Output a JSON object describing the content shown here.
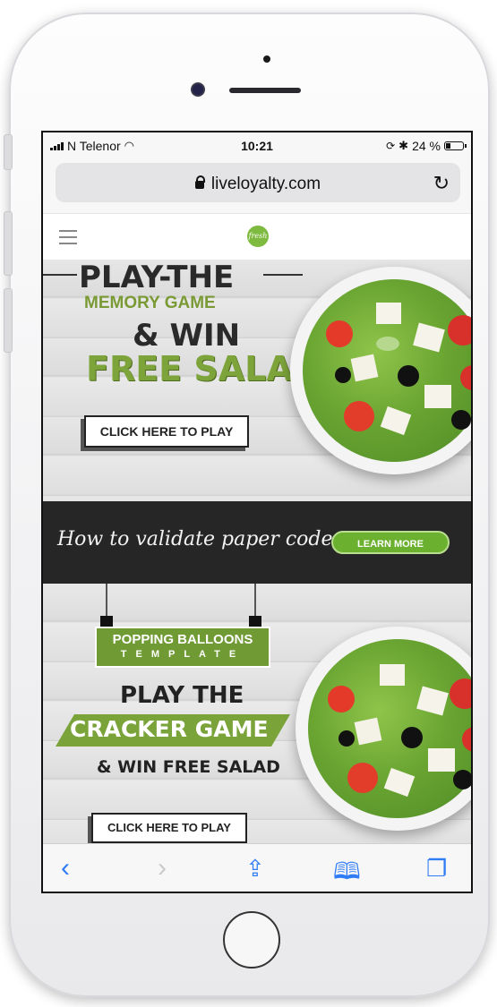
{
  "statusbar": {
    "carrier": "N Telenor",
    "time": "10:21",
    "battery": "24 %"
  },
  "browser": {
    "url": "liveloyalty.com"
  },
  "site": {
    "logo_text": "fresh"
  },
  "banner_memory": {
    "title": "PLAY-THE",
    "subtitle": "MEMORY GAME",
    "win": "& WIN",
    "prize": "FREE SALAD",
    "cta": "CLICK HERE TO PLAY"
  },
  "banner_codes": {
    "text": "How to validate paper codes.",
    "cta": "LEARN MORE"
  },
  "banner_cracker": {
    "tag_line1": "POPPING BALLOONS",
    "tag_line2": "TEMPLATE",
    "play": "PLAY THE",
    "game": "CRACKER GAME",
    "win": "& WIN FREE SALAD",
    "cta": "CLICK HERE TO PLAY"
  },
  "toolbar": {
    "icons": [
      "back-icon",
      "forward-icon",
      "share-icon",
      "bookmarks-icon",
      "tabs-icon"
    ]
  },
  "colors": {
    "accent_green": "#7da43b",
    "ios_blue": "#2f7cf6",
    "dark_band": "#262626"
  }
}
